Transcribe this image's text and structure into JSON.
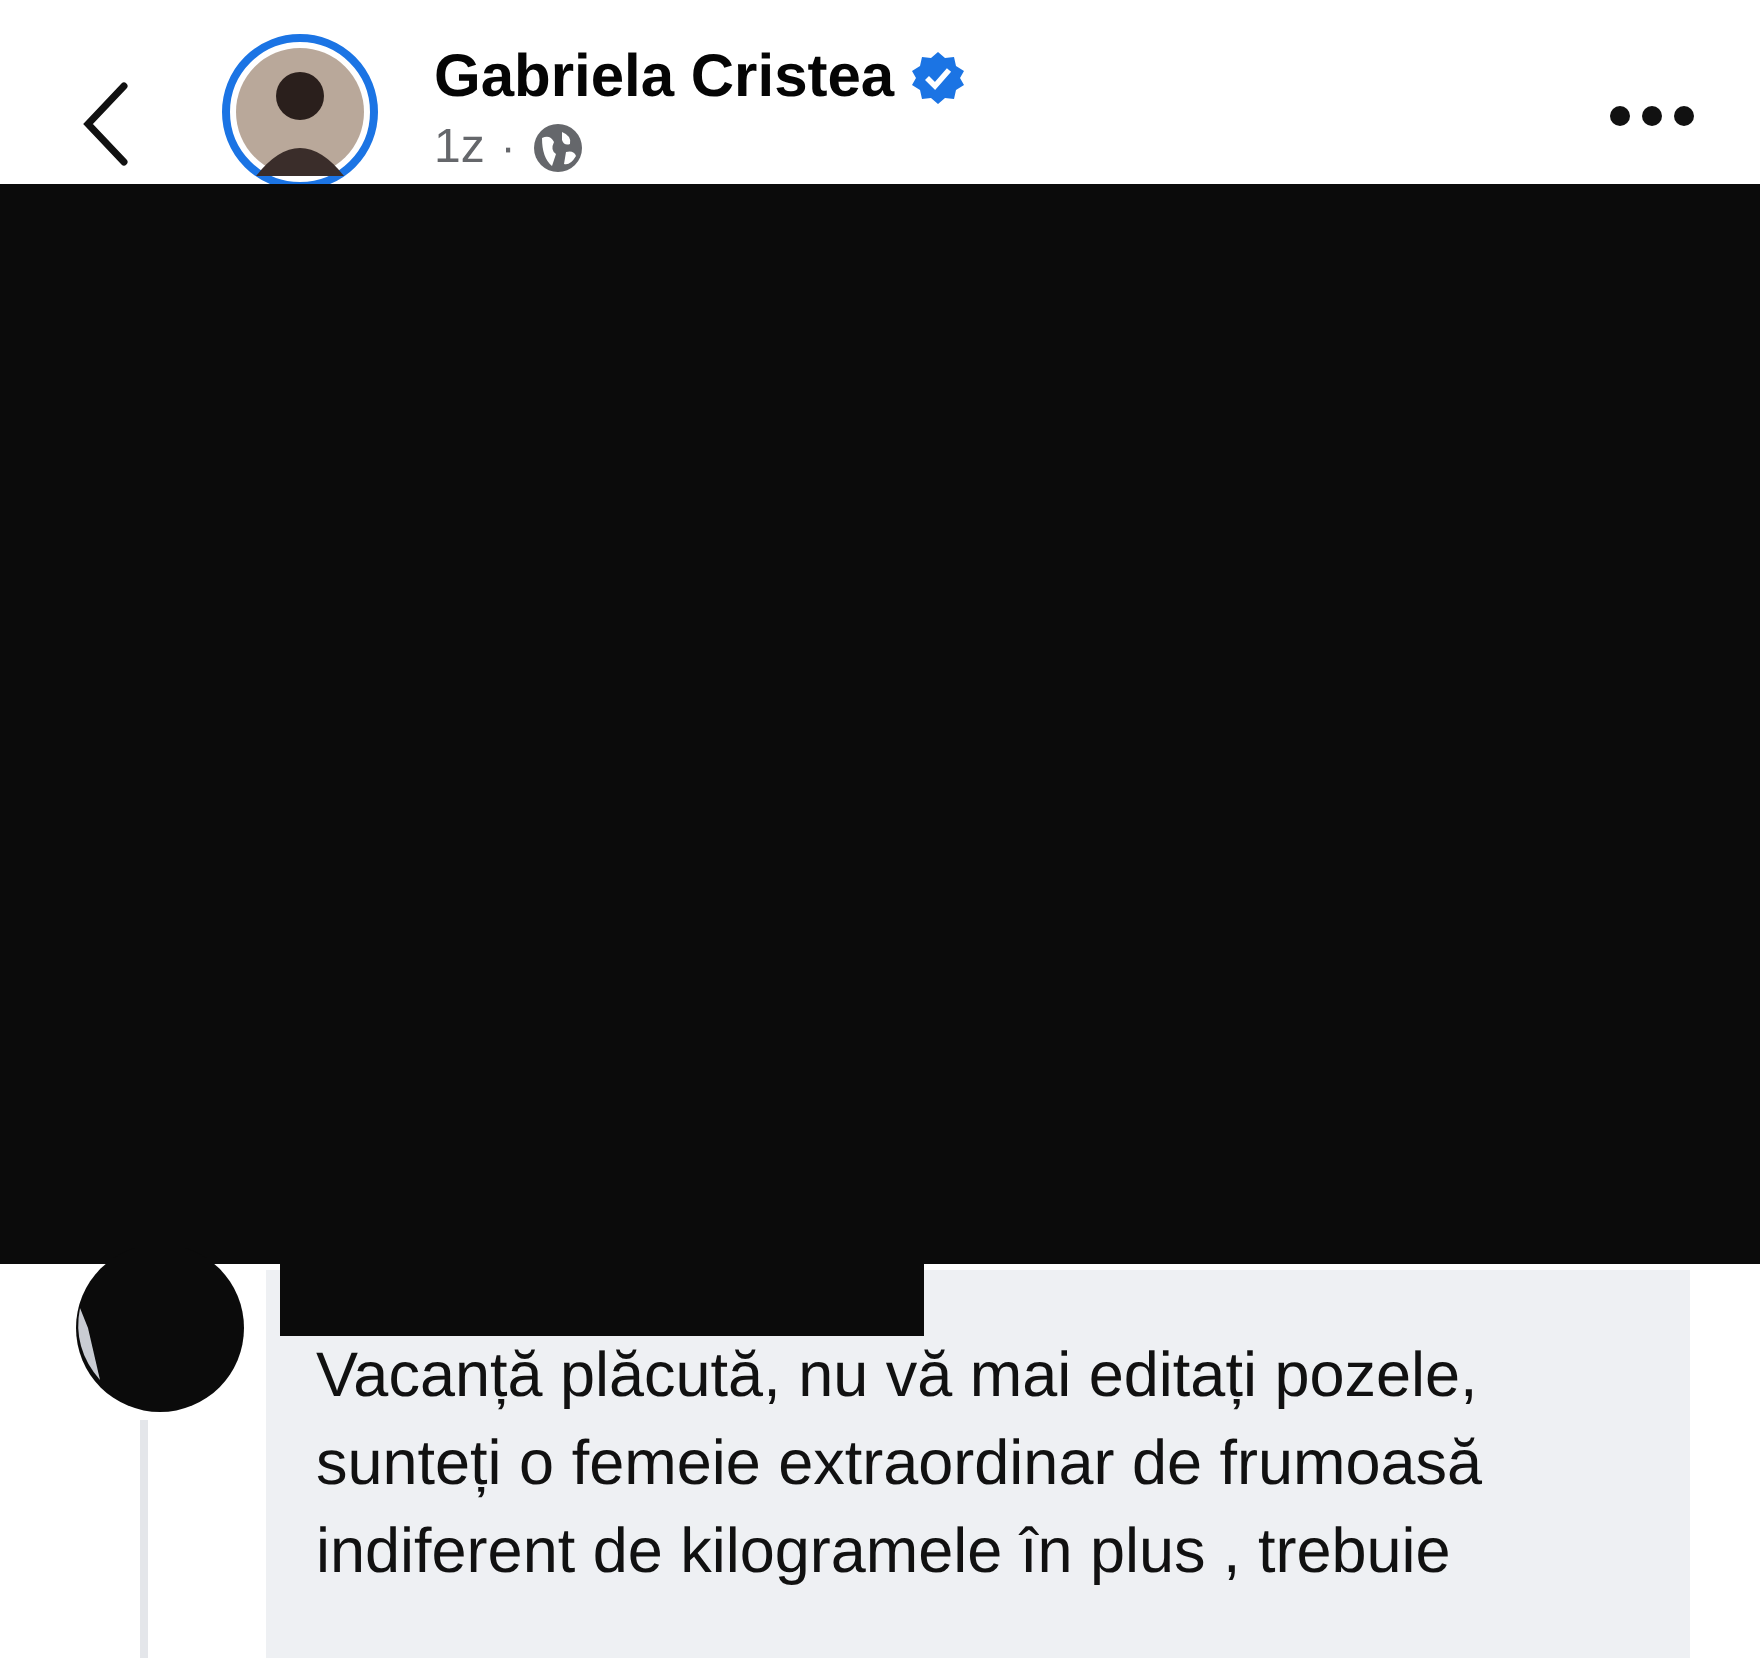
{
  "post_header": {
    "author": "Gabriela Cristea",
    "verified": true,
    "time": "1z",
    "separator": "·"
  },
  "comment": {
    "text": "Vacanță plăcută, nu vă mai editați pozele, sunteți o femeie extraordinar de frumoasă indiferent de kilogramele în plus , trebuie"
  }
}
